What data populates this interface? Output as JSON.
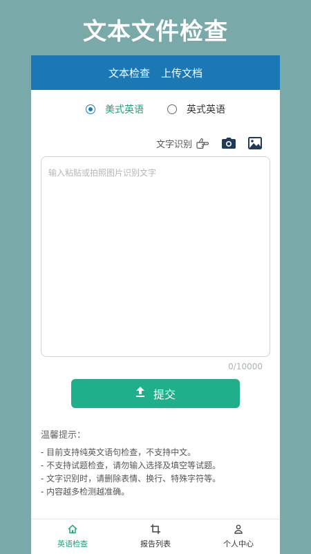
{
  "header": {
    "title": "文本文件检查"
  },
  "tabs": [
    {
      "label": "文本检查"
    },
    {
      "label": "上传文档"
    }
  ],
  "radio": {
    "options": [
      {
        "label": "美式英语",
        "selected": true
      },
      {
        "label": "英式英语",
        "selected": false
      }
    ]
  },
  "ocr": {
    "label": "文字识别",
    "icons": [
      "hand-pointing-icon",
      "camera-icon",
      "image-icon"
    ]
  },
  "input": {
    "placeholder": "输入粘贴或拍照图片识别文字",
    "counter": "0/10000"
  },
  "submit": {
    "label": "提交"
  },
  "tips": {
    "title": "温馨提示：",
    "items": [
      "- 目前支持纯英文语句检查，不支持中文。",
      "- 不支持试题检查，请勿输入选择及填空等试题。",
      "- 文字识别时，请删除表情、换行、特殊字符等。",
      "- 内容越多检测越准确。"
    ]
  },
  "nav": {
    "items": [
      {
        "label": "英语检查",
        "icon": "home-icon",
        "active": true
      },
      {
        "label": "报告列表",
        "icon": "crop-icon",
        "active": false
      },
      {
        "label": "个人中心",
        "icon": "user-icon",
        "active": false
      }
    ]
  },
  "colors": {
    "background": "#7aa9aa",
    "tabbar": "#1c78b4",
    "accent": "#1faf8a",
    "active_text": "#1aa37e"
  }
}
